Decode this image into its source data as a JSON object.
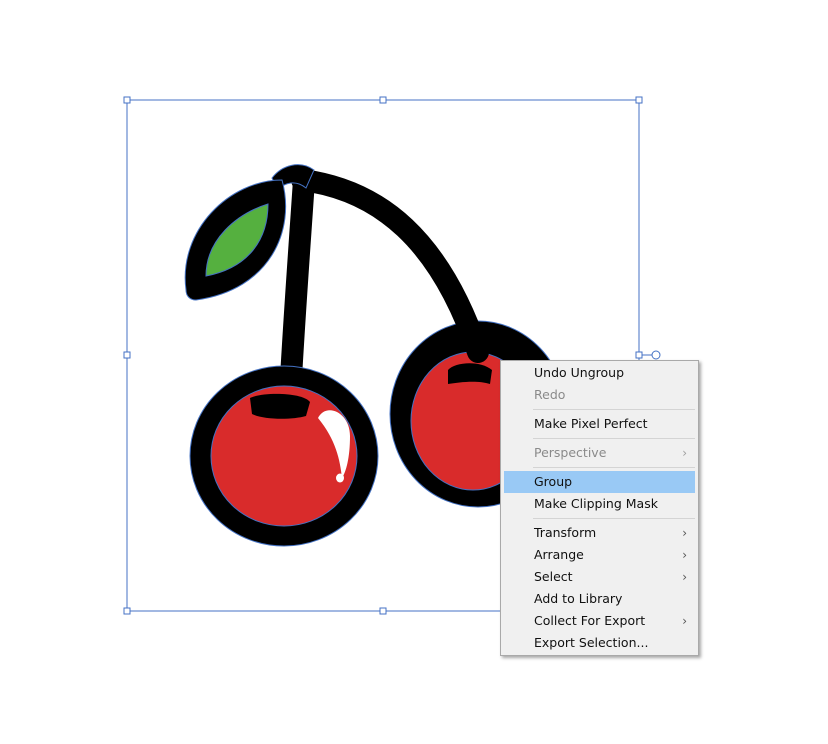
{
  "context_menu": {
    "highlight_color": "#99c9f5",
    "items": [
      {
        "label": "Undo Ungroup",
        "enabled": true,
        "submenu": false
      },
      {
        "label": "Redo",
        "enabled": false,
        "submenu": false
      },
      {
        "label": "Make Pixel Perfect",
        "enabled": true,
        "submenu": false
      },
      {
        "label": "Perspective",
        "enabled": false,
        "submenu": true,
        "submenu_icon": "chevron-right-icon"
      },
      {
        "label": "Group",
        "enabled": true,
        "submenu": false,
        "highlighted": true
      },
      {
        "label": "Make Clipping Mask",
        "enabled": true,
        "submenu": false
      },
      {
        "label": "Transform",
        "enabled": true,
        "submenu": true,
        "submenu_icon": "chevron-right-icon"
      },
      {
        "label": "Arrange",
        "enabled": true,
        "submenu": true,
        "submenu_icon": "chevron-right-icon"
      },
      {
        "label": "Select",
        "enabled": true,
        "submenu": true,
        "submenu_icon": "chevron-right-icon"
      },
      {
        "label": "Add to Library",
        "enabled": true,
        "submenu": false
      },
      {
        "label": "Collect For Export",
        "enabled": true,
        "submenu": true,
        "submenu_icon": "chevron-right-icon"
      },
      {
        "label": "Export Selection...",
        "enabled": true,
        "submenu": false
      }
    ]
  },
  "artwork": {
    "subject": "cherry-illustration",
    "colors": {
      "outline": "#000000",
      "cherry_fill": "#d92b2b",
      "leaf_fill": "#55b03f",
      "highlight": "#ffffff",
      "selection": "#4472c4"
    }
  }
}
